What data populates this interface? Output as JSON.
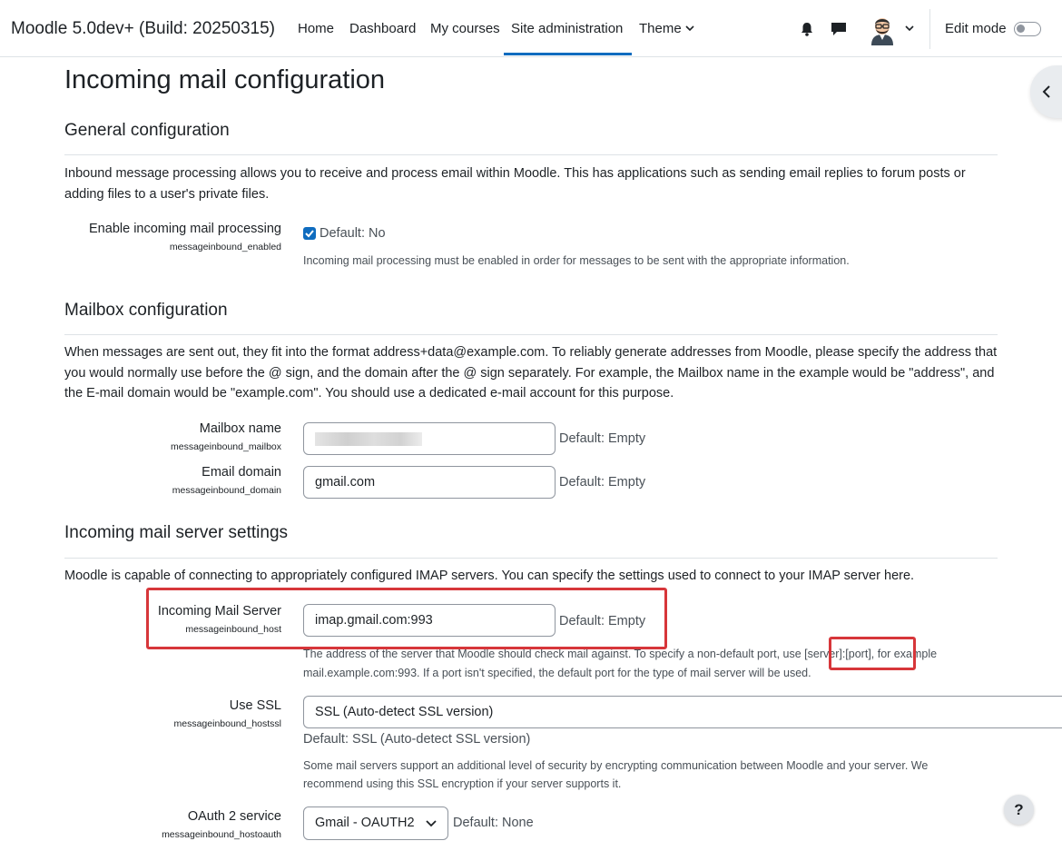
{
  "navbar": {
    "brand": "Moodle 5.0dev+ (Build: 20250315)",
    "items": [
      {
        "label": "Home"
      },
      {
        "label": "Dashboard"
      },
      {
        "label": "My courses"
      },
      {
        "label": "Site administration",
        "active": true
      },
      {
        "label": "Theme",
        "has_dropdown": true
      }
    ],
    "icons": [
      "bell-icon",
      "chat-icon",
      "user-avatar",
      "chevron-down-icon"
    ],
    "edit_mode_label": "Edit mode",
    "edit_mode_on": false
  },
  "page": {
    "title": "Incoming mail configuration"
  },
  "general": {
    "title": "General configuration",
    "intro": "Inbound message processing allows you to receive and process email within Moodle. This has applications such as sending email replies to forum posts or adding files to a user's private files.",
    "enabled": {
      "label": "Enable incoming mail processing",
      "key": "messageinbound_enabled",
      "checked": true,
      "default": "Default: No",
      "description": "Incoming mail processing must be enabled in order for messages to be sent with the appropriate information."
    }
  },
  "mailbox": {
    "title": "Mailbox configuration",
    "intro": "When messages are sent out, they fit into the format address+data@example.com. To reliably generate addresses from Moodle, please specify the address that you would normally use before the @ sign, and the domain after the @ sign separately. For example, the Mailbox name in the example would be \"address\", and the E-mail domain would be \"example.com\". You should use a dedicated e-mail account for this purpose.",
    "name": {
      "label": "Mailbox name",
      "key": "messageinbound_mailbox",
      "value": "",
      "default": "Default: Empty"
    },
    "domain": {
      "label": "Email domain",
      "key": "messageinbound_domain",
      "value": "gmail.com",
      "default": "Default: Empty"
    }
  },
  "server": {
    "title": "Incoming mail server settings",
    "intro": "Moodle is capable of connecting to appropriately configured IMAP servers. You can specify the settings used to connect to your IMAP server here.",
    "host": {
      "label": "Incoming Mail Server",
      "key": "messageinbound_host",
      "value": "imap.gmail.com:993",
      "default": "Default: Empty",
      "description_line1": "The address of the server that Moodle should check mail against. To specify a non-default port, use [server]:[port], for example",
      "description_line2": "mail.example.com:993. If a port isn't specified, the default port for the type of mail server will be used."
    },
    "ssl": {
      "label": "Use SSL",
      "key": "messageinbound_hostssl",
      "value": "SSL (Auto-detect SSL version)",
      "default": "Default: SSL (Auto-detect SSL version)",
      "description_line1": "Some mail servers support an additional level of security by encrypting communication between Moodle and your server. We",
      "description_line2": "recommend using this SSL encryption if your server supports it."
    },
    "oauth": {
      "label": "OAuth 2 service",
      "key": "messageinbound_hostoauth",
      "value": "Gmail - OAUTH2",
      "default": "Default: None"
    }
  },
  "help_button": "?",
  "colors": {
    "accent": "#0f6cbf",
    "highlight": "#d7363a"
  }
}
